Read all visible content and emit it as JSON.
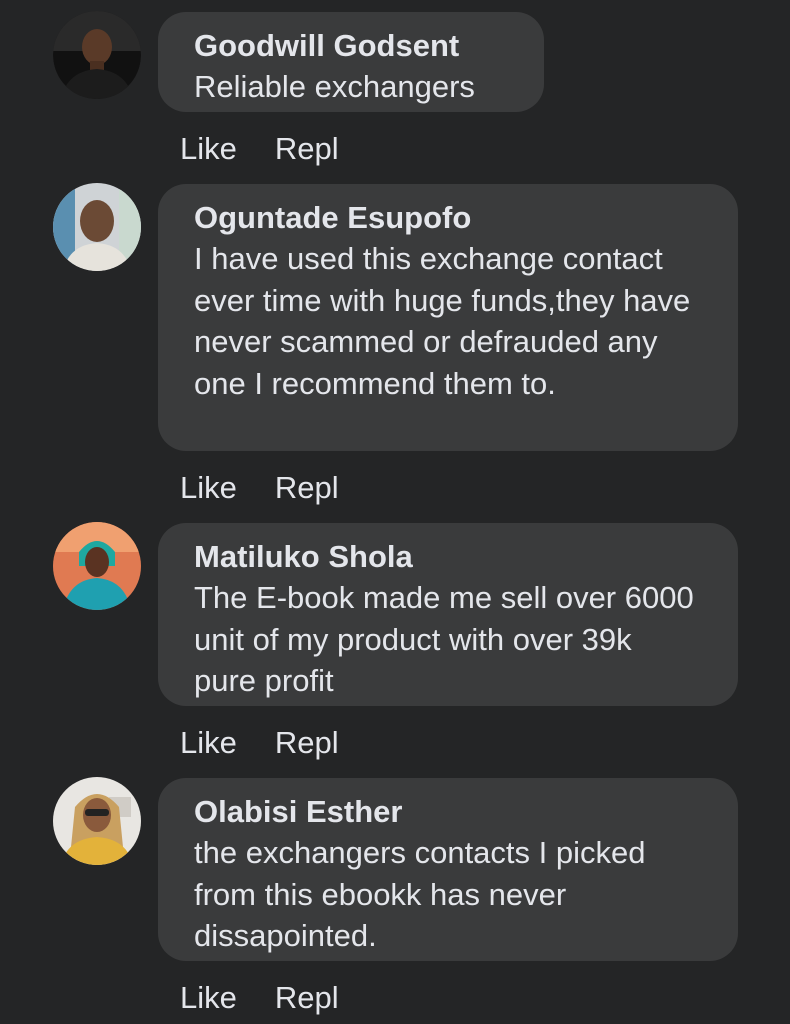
{
  "comments": [
    {
      "author": "Goodwill Godsent",
      "text": "Reliable exchangers",
      "like_label": "Like",
      "reply_label": "Repl"
    },
    {
      "author": "Oguntade Esupofo",
      "text": "I have used this exchange contact ever time with huge funds,they have never scammed or defrauded any one I recommend them to.",
      "like_label": "Like",
      "reply_label": "Repl"
    },
    {
      "author": "Matiluko Shola",
      "text": "The E-book made me sell over 6000 unit of my product with over 39k pure profit",
      "like_label": "Like",
      "reply_label": "Repl"
    },
    {
      "author": "Olabisi Esther",
      "text": "the exchangers contacts I picked from this ebookk has never dissapointed.",
      "like_label": "Like",
      "reply_label": "Repl"
    }
  ],
  "colors": {
    "background": "#242526",
    "bubble": "#3a3b3c",
    "text": "#e4e6eb"
  }
}
